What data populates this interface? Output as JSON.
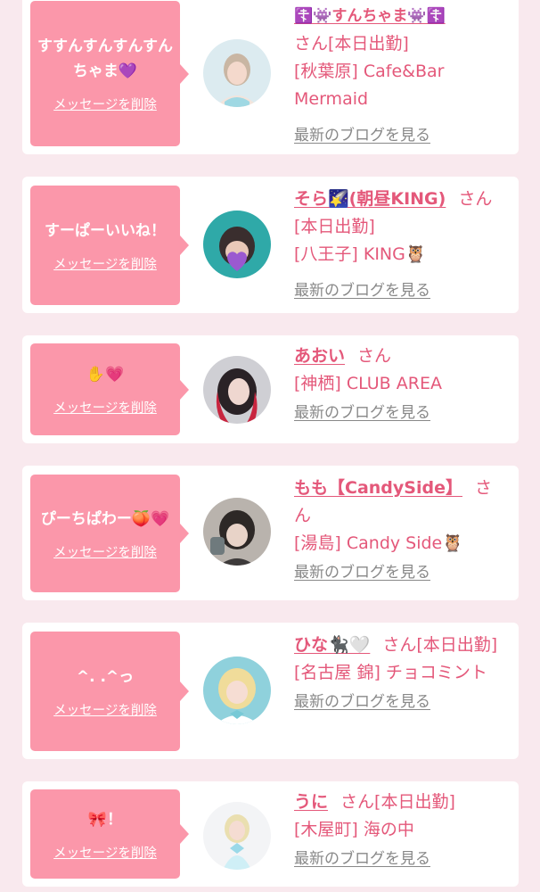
{
  "messages": [
    {
      "message": "すすんすんすんすんちゃま💜",
      "delete_label": "メッセージを削除",
      "name": "☦️👾すんちゃま👾☦️",
      "honorific": "さん",
      "status": "[本日出勤]",
      "store": "[秋葉原] Cafe&Bar Mermaid",
      "blog_label": "最新のブログを見る"
    },
    {
      "message": "すーぱーいいね！",
      "delete_label": "メッセージを削除",
      "name": "そら🌠(朝昼KING)",
      "honorific": "さん",
      "status": "[本日出勤]",
      "store": "[八王子] KING🦉",
      "blog_label": "最新のブログを見る"
    },
    {
      "message": "✋💗",
      "delete_label": "メッセージを削除",
      "name": "あおい",
      "honorific": "さん",
      "status": "",
      "store": "[神栖] CLUB AREA",
      "blog_label": "最新のブログを見る"
    },
    {
      "message": "ぴーちぱわー🍑💗",
      "delete_label": "メッセージを削除",
      "name": "もも【CandySide】",
      "honorific": "さん",
      "status": "",
      "store": "[湯島] Candy Side🦉",
      "blog_label": "最新のブログを見る"
    },
    {
      "message": "^. .^っ",
      "delete_label": "メッセージを削除",
      "name": "ひな🐈‍⬛🤍",
      "honorific": "さん",
      "status": "[本日出勤]",
      "store": "[名古屋 錦] チョコミント",
      "blog_label": "最新のブログを見る"
    },
    {
      "message": "🎀！",
      "delete_label": "メッセージを削除",
      "name": "うに",
      "honorific": "さん",
      "status": "[本日出勤]",
      "store": "[木屋町] 海の中",
      "blog_label": "最新のブログを見る"
    }
  ],
  "colors": {
    "page_bg": "#f9e9ee",
    "bubble": "#fb97aa",
    "accent_text": "#e4587a",
    "link_gray": "#888888"
  }
}
